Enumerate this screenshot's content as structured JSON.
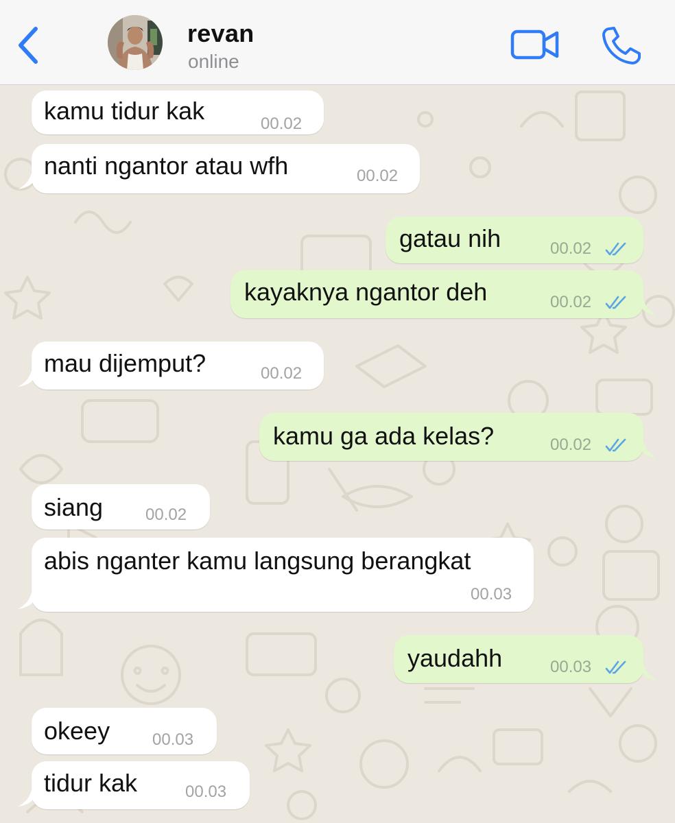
{
  "header": {
    "back_icon": "chevron-left-icon",
    "contact_name": "revan",
    "status": "online",
    "video_icon": "video-camera-icon",
    "call_icon": "phone-icon",
    "accent_color": "#2f7cf6"
  },
  "colors": {
    "incoming_bubble": "#ffffff",
    "outgoing_bubble": "#e2f7cb",
    "read_ticks": "#5ba4e5",
    "chat_background": "#ede8df"
  },
  "messages": [
    {
      "direction": "in",
      "text": "kamu tidur kak",
      "time": "00.02"
    },
    {
      "direction": "in",
      "text": "nanti ngantor atau wfh",
      "time": "00.02"
    },
    {
      "direction": "out",
      "text": "gatau nih",
      "time": "00.02",
      "status": "read"
    },
    {
      "direction": "out",
      "text": "kayaknya ngantor deh",
      "time": "00.02",
      "status": "read"
    },
    {
      "direction": "in",
      "text": "mau dijemput?",
      "time": "00.02"
    },
    {
      "direction": "out",
      "text": "kamu ga ada kelas?",
      "time": "00.02",
      "status": "read"
    },
    {
      "direction": "in",
      "text": "siang",
      "time": "00.02"
    },
    {
      "direction": "in",
      "text": "abis nganter kamu langsung berangkat",
      "time": "00.03"
    },
    {
      "direction": "out",
      "text": "yaudahh",
      "time": "00.03",
      "status": "read"
    },
    {
      "direction": "in",
      "text": "okeey",
      "time": "00.03"
    },
    {
      "direction": "in",
      "text": "tidur kak",
      "time": "00.03"
    }
  ]
}
